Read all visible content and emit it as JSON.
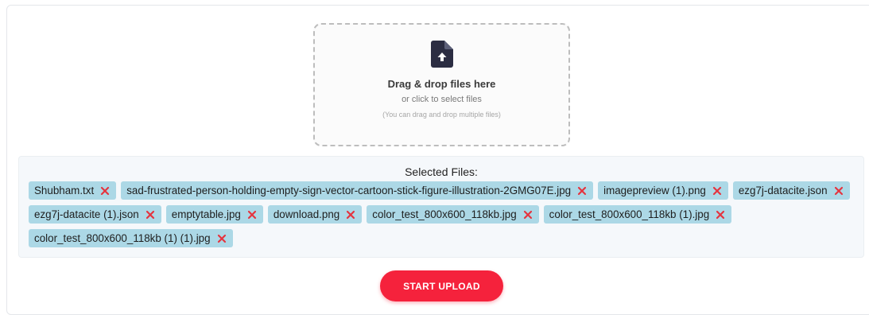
{
  "dropzone": {
    "icon": "file-upload-icon",
    "title": "Drag & drop files here",
    "subtitle": "or click to select files",
    "note": "(You can drag and drop multiple files)"
  },
  "selected_files": {
    "title": "Selected Files:",
    "remove_icon": "close-icon",
    "files": [
      "Shubham.txt",
      "sad-frustrated-person-holding-empty-sign-vector-cartoon-stick-figure-illustration-2GMG07E.jpg",
      "imagepreview (1).png",
      "ezg7j-datacite.json",
      "ezg7j-datacite (1).json",
      "emptytable.jpg",
      "download.png",
      "color_test_800x600_118kb.jpg",
      "color_test_800x600_118kb (1).jpg",
      "color_test_800x600_118kb (1) (1).jpg"
    ]
  },
  "upload_button": {
    "label": "START UPLOAD"
  },
  "colors": {
    "chip_background": "#acd8e6",
    "remove_icon": "#e5343f",
    "primary_button": "#f5223c",
    "icon_dark": "#2b2d42"
  }
}
